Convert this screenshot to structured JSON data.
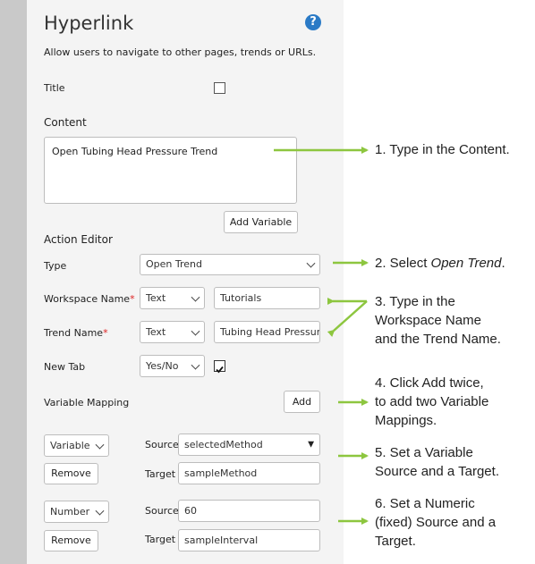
{
  "dialog": {
    "title": "Hyperlink",
    "help_icon": "question-circle-icon",
    "help_glyph": "?",
    "description": "Allow users to navigate to other pages, trends or URLs.",
    "title_label": "Title",
    "content_label": "Content",
    "content_value": "Open Tubing Head Pressure Trend",
    "add_variable_label": "Add Variable",
    "action_editor_label": "Action Editor",
    "type_label": "Type",
    "type_value": "Open Trend",
    "workspace_label": "Workspace Name",
    "workspace_type": "Text",
    "workspace_value": "Tutorials",
    "trend_label": "Trend Name",
    "trend_type": "Text",
    "trend_value": "Tubing Head Pressure",
    "required_mark": "*",
    "newtab_label": "New Tab",
    "newtab_value": "Yes/No",
    "newtab_checked": true,
    "variable_mapping_label": "Variable Mapping",
    "add_label": "Add",
    "mappings": [
      {
        "kind": "Variable",
        "remove_label": "Remove",
        "source_label": "Source",
        "source_value": "selectedMethod",
        "target_label": "Target",
        "target_value": "sampleMethod"
      },
      {
        "kind": "Number",
        "remove_label": "Remove",
        "source_label": "Source",
        "source_value": "60",
        "target_label": "Target",
        "target_value": "sampleInterval"
      }
    ]
  },
  "annotations": {
    "note1": "1. Type in the Content.",
    "note2_prefix": "2. Select ",
    "note2_em": "Open Trend",
    "note2_suffix": ".",
    "note3_l1": "3. Type in the",
    "note3_l2": "Workspace Name",
    "note3_l3": "and the Trend Name.",
    "note4_l1": "4. Click Add twice,",
    "note4_l2": "to add two Variable",
    "note4_l3": "Mappings.",
    "note5_l1": "5. Set a Variable",
    "note5_l2": "Source and a Target.",
    "note6_l1": "6. Set a Numeric",
    "note6_l2": "(fixed) Source and a",
    "note6_l3": "Target.",
    "arrow_color": "#8dc63f"
  }
}
